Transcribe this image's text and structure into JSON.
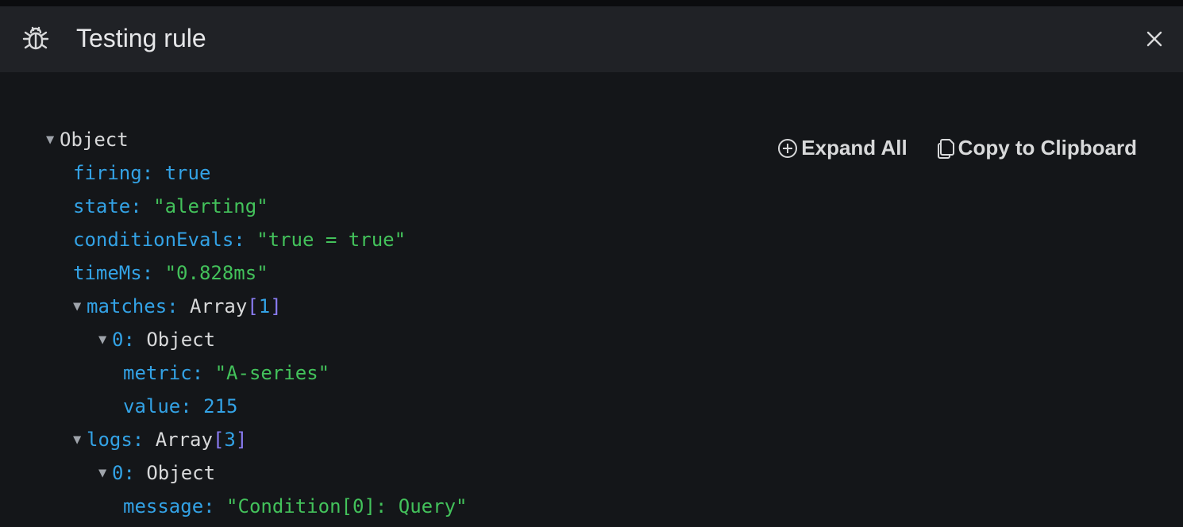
{
  "header": {
    "title": "Testing rule"
  },
  "actions": {
    "expand_all": "Expand All",
    "copy_to_clipboard": "Copy to Clipboard"
  },
  "tree": {
    "root_label": "Object",
    "firing_key": "firing:",
    "firing_value": "true",
    "state_key": "state:",
    "state_value": "\"alerting\"",
    "conditionEvals_key": "conditionEvals:",
    "conditionEvals_value": "\"true = true\"",
    "timeMs_key": "timeMs:",
    "timeMs_value": "\"0.828ms\"",
    "matches_key": "matches:",
    "matches_type": "Array",
    "matches_count": "1",
    "matches_0_key": "0:",
    "matches_0_type": "Object",
    "metric_key": "metric:",
    "metric_value": "\"A-series\"",
    "value_key": "value:",
    "value_value": "215",
    "logs_key": "logs:",
    "logs_type": "Array",
    "logs_count": "3",
    "logs_0_key": "0:",
    "logs_0_type": "Object",
    "message_key": "message:",
    "message_value": "\"Condition[0]: Query\""
  },
  "icons": {
    "header": "bug-icon",
    "close": "close-icon",
    "expand": "plus-circle-icon",
    "copy": "copy-icon",
    "caret": "caret-down-icon"
  },
  "colors": {
    "background": "#141619",
    "header_bg": "#202226",
    "key": "#33a2e5",
    "string": "#43c25b",
    "bracket": "#8a7cf2"
  }
}
